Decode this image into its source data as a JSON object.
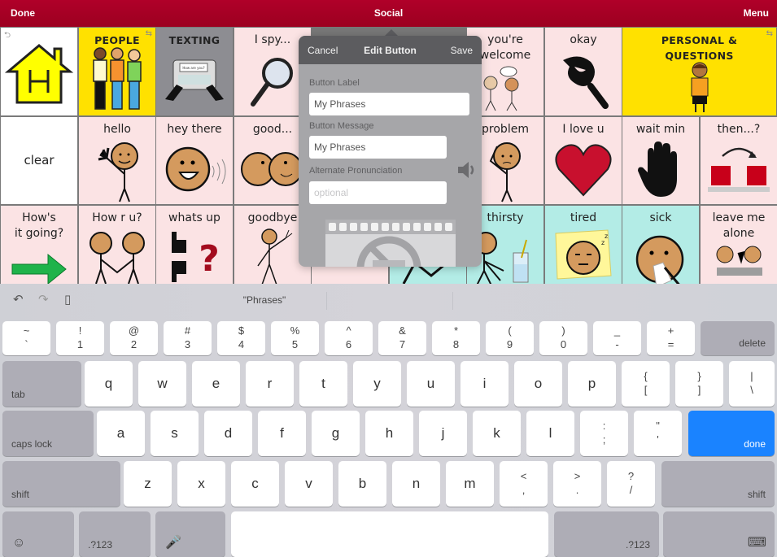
{
  "topbar": {
    "left_button": "Done",
    "title": "Social",
    "right_button": "Menu",
    "bar_color": "#a50022"
  },
  "grid": {
    "cells": [
      {
        "row": 0,
        "col": 0,
        "label": "",
        "icon": "home-house-icon",
        "color": "white",
        "corner": "back-arrow-icon"
      },
      {
        "row": 0,
        "col": 1,
        "label": "PEOPLE",
        "icon": "three-people-icon",
        "color": "yellow",
        "corner": "folder-link-icon",
        "caps": true
      },
      {
        "row": 0,
        "col": 2,
        "label": "TEXTING",
        "icon": "phone-texting-icon",
        "color": "gray",
        "caps": true,
        "phone_text": "How are you?"
      },
      {
        "row": 0,
        "col": 3,
        "label": "I spy...",
        "icon": "magnifying-glass-icon",
        "color": "pink"
      },
      {
        "row": 0,
        "col": 6,
        "label": "you're\nwelcome",
        "icon": "two-people-talking-icon",
        "color": "pink"
      },
      {
        "row": 0,
        "col": 7,
        "label": "okay",
        "icon": "ok-hand-icon",
        "color": "pink"
      },
      {
        "row": 0,
        "col": 8,
        "label": "PERSONAL &\nQUESTIONS",
        "icon": "boy-icon",
        "color": "yellow",
        "caps": true,
        "span": 2,
        "corner": "folder-link-icon"
      },
      {
        "row": 1,
        "col": 0,
        "label": "clear",
        "icon": "",
        "color": "white",
        "center": true
      },
      {
        "row": 1,
        "col": 1,
        "label": "hello",
        "icon": "waving-person-icon",
        "color": "pink"
      },
      {
        "row": 1,
        "col": 2,
        "label": "hey there",
        "icon": "smiling-face-icon",
        "color": "pink"
      },
      {
        "row": 1,
        "col": 3,
        "label": "good...",
        "icon": "kissing-faces-icon",
        "color": "pink"
      },
      {
        "row": 1,
        "col": 6,
        "label": "problem",
        "icon": "worried-person-icon",
        "color": "pink"
      },
      {
        "row": 1,
        "col": 7,
        "label": "I love u",
        "icon": "heart-icon",
        "color": "pink"
      },
      {
        "row": 1,
        "col": 8,
        "label": "wait min",
        "icon": "stop-hand-icon",
        "color": "pink"
      },
      {
        "row": 1,
        "col": 9,
        "label": "then...?",
        "icon": "two-squares-arrow-icon",
        "color": "pink"
      },
      {
        "row": 2,
        "col": 0,
        "label": "How's\nit going?",
        "icon": "green-arrow-icon",
        "color": "pink"
      },
      {
        "row": 2,
        "col": 1,
        "label": "How r u?",
        "icon": "handshake-icon",
        "color": "pink"
      },
      {
        "row": 2,
        "col": 2,
        "label": "whats up",
        "icon": "thumbs-question-icon",
        "color": "pink"
      },
      {
        "row": 2,
        "col": 3,
        "label": "goodbye",
        "icon": "walking-waving-icon",
        "color": "pink"
      },
      {
        "row": 2,
        "col": 4,
        "label": "",
        "icon": "",
        "color": "pink"
      },
      {
        "row": 2,
        "col": 5,
        "label": "",
        "icon": "running-person-icon",
        "color": "teal"
      },
      {
        "row": 2,
        "col": 6,
        "label": "thirsty",
        "icon": "thirsty-glass-icon",
        "color": "teal"
      },
      {
        "row": 2,
        "col": 7,
        "label": "tired",
        "icon": "sleeping-face-icon",
        "color": "teal"
      },
      {
        "row": 2,
        "col": 8,
        "label": "sick",
        "icon": "sick-face-icon",
        "color": "teal"
      },
      {
        "row": 2,
        "col": 9,
        "label": "leave me\nalone",
        "icon": "two-people-icon",
        "color": "pink"
      }
    ],
    "colors": {
      "white": "#ffffff",
      "yellow": "#ffe100",
      "gray": "#8d8d92",
      "pink": "#fbe3e4",
      "teal": "#b3ece6"
    }
  },
  "popover": {
    "cancel": "Cancel",
    "title": "Edit Button",
    "save": "Save",
    "label_field": {
      "label": "Button Label",
      "value": "My Phrases"
    },
    "message_field": {
      "label": "Button Message",
      "value": "My Phrases"
    },
    "pronunciation_field": {
      "label": "Alternate Pronunciation",
      "value": "",
      "placeholder": "optional"
    },
    "speaker_icon": "speaker-icon",
    "image_placeholder_icon": "no-image-icon"
  },
  "keyboard": {
    "toolbar": {
      "undo_icon": "undo-icon",
      "redo_icon": "redo-icon",
      "paste_icon": "clipboard-icon",
      "suggestion": "\"Phrases\""
    },
    "rows": [
      [
        {
          "top": "~",
          "bottom": "`"
        },
        {
          "top": "!",
          "bottom": "1"
        },
        {
          "top": "@",
          "bottom": "2"
        },
        {
          "top": "#",
          "bottom": "3"
        },
        {
          "top": "$",
          "bottom": "4"
        },
        {
          "top": "%",
          "bottom": "5"
        },
        {
          "top": "^",
          "bottom": "6"
        },
        {
          "top": "&",
          "bottom": "7"
        },
        {
          "top": "*",
          "bottom": "8"
        },
        {
          "top": "(",
          "bottom": "9"
        },
        {
          "top": ")",
          "bottom": "0"
        },
        {
          "top": "_",
          "bottom": "-"
        },
        {
          "top": "+",
          "bottom": "="
        },
        {
          "label": "delete",
          "fn": true
        }
      ],
      [
        {
          "label": "tab",
          "fn": true
        },
        {
          "main": "q"
        },
        {
          "main": "w"
        },
        {
          "main": "e"
        },
        {
          "main": "r"
        },
        {
          "main": "t"
        },
        {
          "main": "y"
        },
        {
          "main": "u"
        },
        {
          "main": "i"
        },
        {
          "main": "o"
        },
        {
          "main": "p"
        },
        {
          "top": "{",
          "bottom": "["
        },
        {
          "top": "}",
          "bottom": "]"
        },
        {
          "top": "|",
          "bottom": "\\"
        }
      ],
      [
        {
          "label": "caps lock",
          "fn": true
        },
        {
          "main": "a"
        },
        {
          "main": "s"
        },
        {
          "main": "d"
        },
        {
          "main": "f"
        },
        {
          "main": "g"
        },
        {
          "main": "h"
        },
        {
          "main": "j"
        },
        {
          "main": "k"
        },
        {
          "main": "l"
        },
        {
          "top": ":",
          "bottom": ";"
        },
        {
          "top": "\"",
          "bottom": "'"
        },
        {
          "label": "done",
          "fn": true,
          "blue": true
        }
      ],
      [
        {
          "label": "shift",
          "fn": true
        },
        {
          "main": "z"
        },
        {
          "main": "x"
        },
        {
          "main": "c"
        },
        {
          "main": "v"
        },
        {
          "main": "b"
        },
        {
          "main": "n"
        },
        {
          "main": "m"
        },
        {
          "top": "<",
          "bottom": ","
        },
        {
          "top": ">",
          "bottom": "."
        },
        {
          "top": "?",
          "bottom": "/"
        },
        {
          "label": "shift",
          "fn": true
        }
      ],
      [
        {
          "icon": "emoji-icon",
          "glyph": "☺",
          "fn": true
        },
        {
          "label": ".?123",
          "fn": true
        },
        {
          "icon": "microphone-icon",
          "glyph": "🎤",
          "fn": true
        },
        {
          "label": "",
          "space": true
        },
        {
          "label": ".?123",
          "fn": true
        },
        {
          "icon": "hide-keyboard-icon",
          "glyph": "⌨",
          "fn": true
        }
      ]
    ],
    "done_color": "#1a83ff"
  }
}
